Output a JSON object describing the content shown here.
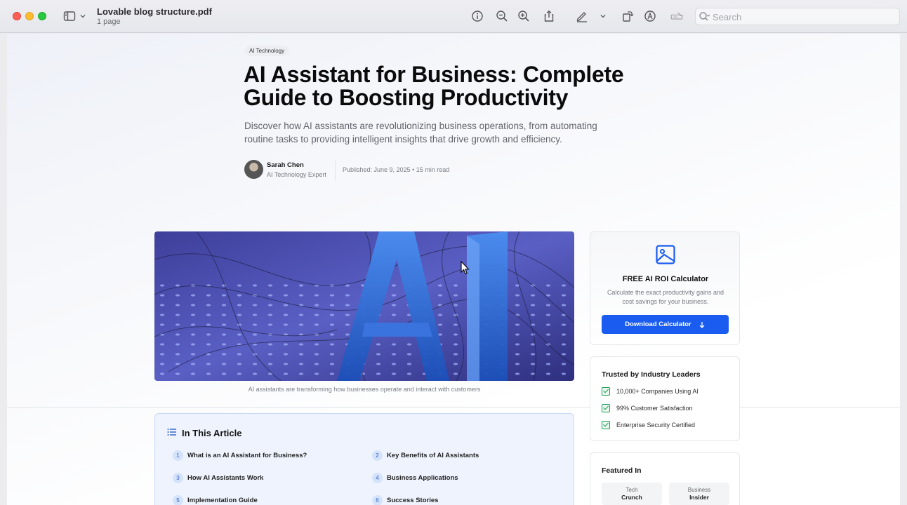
{
  "window": {
    "file_name": "Lovable blog structure.pdf",
    "page_count": "1 page",
    "search_placeholder": "Search",
    "toolbar_icons": [
      "sidebar-icon",
      "chevron-down-icon",
      "info-icon",
      "zoom-out-icon",
      "zoom-in-icon",
      "share-icon",
      "markup-pen-icon",
      "chevron-down-icon",
      "rotate-icon",
      "annotate-icon",
      "form-fill-icon",
      "search-icon"
    ]
  },
  "article": {
    "category": "AI Technology",
    "title": "AI Assistant for Business: Complete Guide to Boosting Productivity",
    "description": "Discover how AI assistants are revolutionizing business operations, from automating routine tasks to providing intelligent insights that drive growth and efficiency.",
    "author": {
      "name": "Sarah Chen",
      "role": "AI Technology Expert"
    },
    "published": "Published: June 9, 2025 • 15 min read",
    "image_caption": "AI assistants are transforming how businesses operate and interact with customers"
  },
  "toc": {
    "title": "In This Article",
    "items": [
      {
        "num": "1",
        "label": "What is an AI Assistant for Business?"
      },
      {
        "num": "2",
        "label": "Key Benefits of AI Assistants"
      },
      {
        "num": "3",
        "label": "How AI Assistants Work"
      },
      {
        "num": "4",
        "label": "Business Applications"
      },
      {
        "num": "5",
        "label": "Implementation Guide"
      },
      {
        "num": "6",
        "label": "Success Stories"
      }
    ]
  },
  "sidebar": {
    "roi": {
      "title": "FREE AI ROI Calculator",
      "description": "Calculate the exact productivity gains and cost savings for your business.",
      "button_label": "Download Calculator",
      "button_color": "#1a5cf0"
    },
    "trust": {
      "title": "Trusted by Industry Leaders",
      "items": [
        "10,000+ Companies Using AI",
        "99% Customer Satisfaction",
        "Enterprise Security Certified"
      ]
    },
    "featured": {
      "title": "Featured In",
      "logos": [
        {
          "line1": "Tech",
          "line2": "Crunch"
        },
        {
          "line1": "Business",
          "line2": "Insider"
        }
      ]
    }
  }
}
